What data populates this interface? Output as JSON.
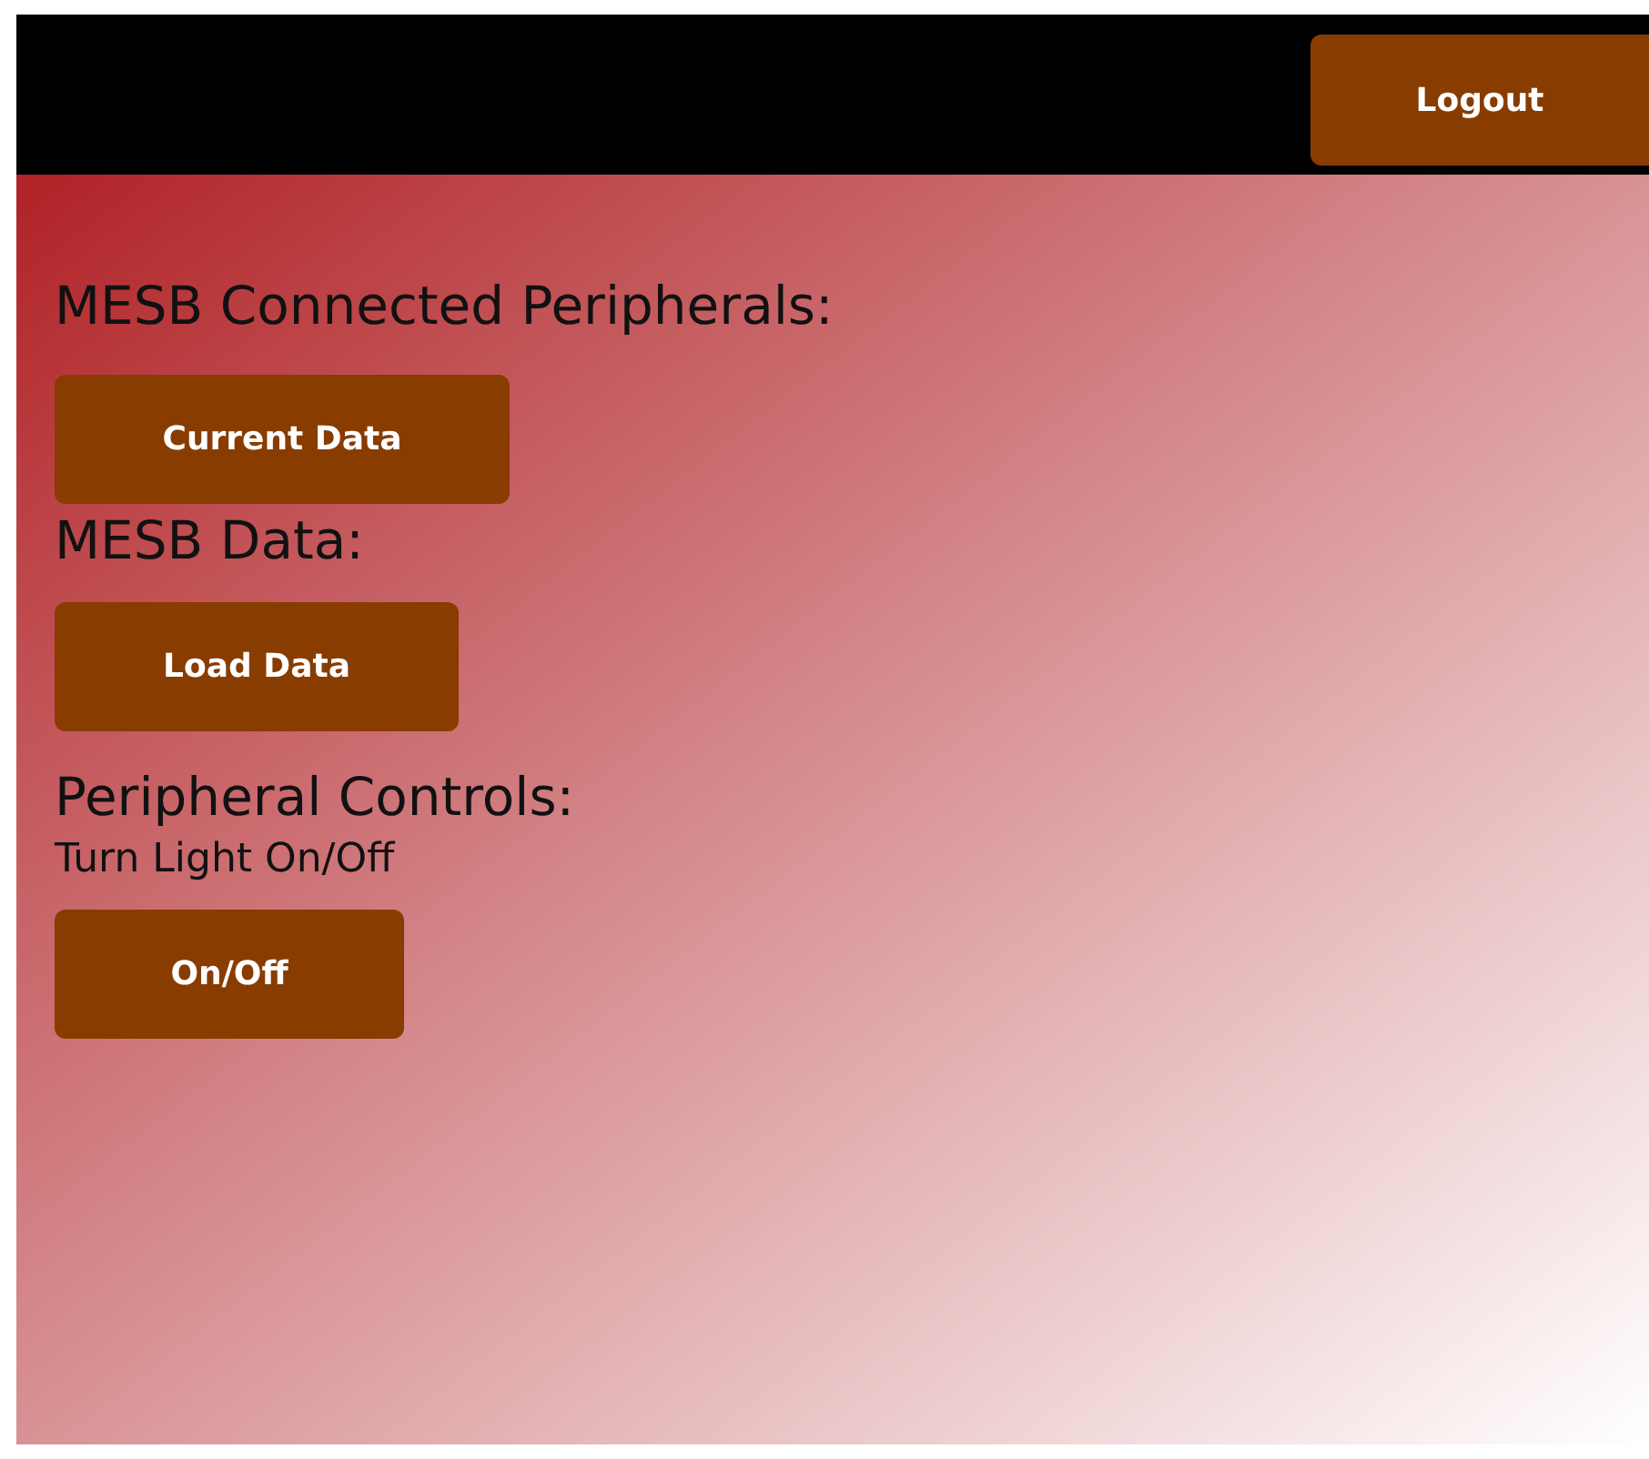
{
  "header": {
    "logout_button": "Logout"
  },
  "sections": [
    {
      "heading": "MESB Connected Peripherals:",
      "button": "Current Data"
    },
    {
      "heading": "MESB Data:",
      "button": "Load Data"
    },
    {
      "heading": "Peripheral Controls:",
      "subheading": "Turn Light On/Off",
      "button": "On/Off"
    }
  ]
}
